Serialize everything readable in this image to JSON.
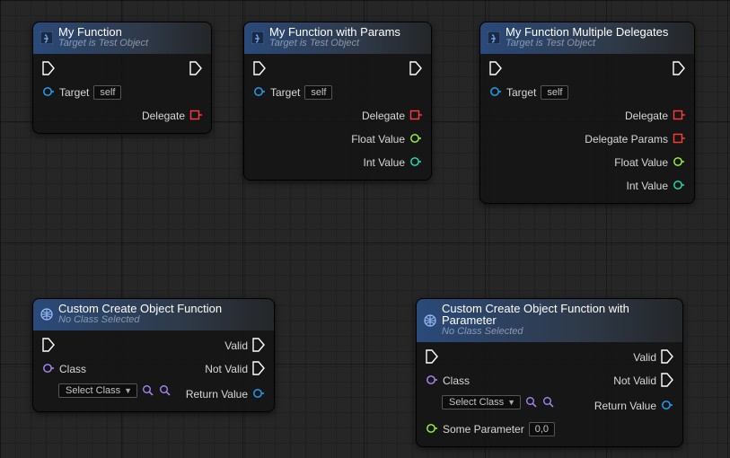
{
  "colors": {
    "exec_pin": "#ffffff",
    "delegate_pin": "#ff3b3b",
    "object_pin": "#1fa7ff",
    "float_pin": "#9bff3a",
    "int_pin": "#23e3b7",
    "magnifier": "#b08bff"
  },
  "common": {
    "target_label": "Target",
    "target_default": "self",
    "delegate_label": "Delegate",
    "class_label": "Class",
    "select_class": "Select Class",
    "valid": "Valid",
    "not_valid": "Not Valid",
    "return_value": "Return Value",
    "float_value": "Float Value",
    "int_value": "Int Value",
    "delegate_params": "Delegate Params",
    "some_parameter": "Some Parameter",
    "vec2_default": "0,0",
    "sub_a": "Target is Test Object",
    "sub_b": "No Class Selected"
  },
  "nodes": {
    "n1": {
      "title": "My Function"
    },
    "n2": {
      "title": "My Function with Params"
    },
    "n3": {
      "title": "My Function Multiple Delegates"
    },
    "n4": {
      "title": "Custom Create Object Function"
    },
    "n5": {
      "title": "Custom Create Object Function with Parameter"
    }
  }
}
